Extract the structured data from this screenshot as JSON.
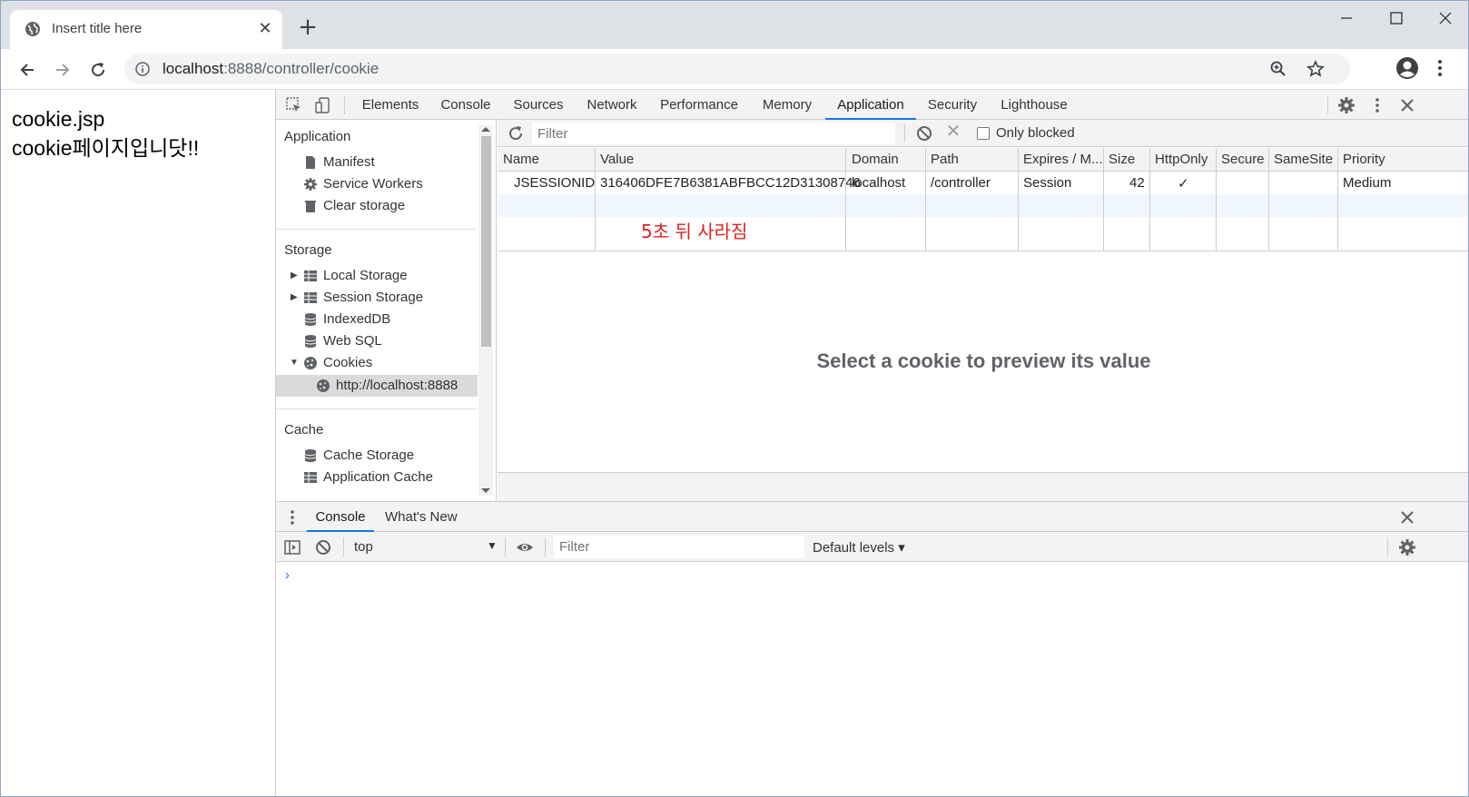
{
  "browser": {
    "tab_title": "Insert title here",
    "url_host": "localhost",
    "url_rest": ":8888/controller/cookie"
  },
  "page": {
    "line1": "cookie.jsp",
    "line2": "cookie페이지입니닷!!"
  },
  "devtools": {
    "tabs": [
      "Elements",
      "Console",
      "Sources",
      "Network",
      "Performance",
      "Memory",
      "Application",
      "Security",
      "Lighthouse"
    ],
    "active_tab": "Application",
    "sidebar": {
      "application_header": "Application",
      "application_items": [
        "Manifest",
        "Service Workers",
        "Clear storage"
      ],
      "storage_header": "Storage",
      "storage_items": [
        "Local Storage",
        "Session Storage",
        "IndexedDB",
        "Web SQL",
        "Cookies"
      ],
      "cookie_origin": "http://localhost:8888",
      "cache_header": "Cache",
      "cache_items": [
        "Cache Storage",
        "Application Cache"
      ]
    },
    "cookies": {
      "filter_placeholder": "Filter",
      "only_blocked_label": "Only blocked",
      "columns": [
        "Name",
        "Value",
        "Domain",
        "Path",
        "Expires / M...",
        "Size",
        "HttpOnly",
        "Secure",
        "SameSite",
        "Priority"
      ],
      "rows": [
        {
          "name": "JSESSIONID",
          "value": "316406DFE7B6381ABFBCC12D31308746",
          "domain": "localhost",
          "path": "/controller",
          "expires": "Session",
          "size": "42",
          "httponly": "✓",
          "secure": "",
          "samesite": "",
          "priority": "Medium"
        }
      ],
      "annotation": "5초 뒤 사라짐",
      "preview_message": "Select a cookie to preview its value"
    },
    "drawer": {
      "tabs": [
        "Console",
        "What's New"
      ],
      "context": "top",
      "filter_placeholder": "Filter",
      "levels": "Default levels ▾",
      "prompt": "›"
    }
  },
  "colors": {
    "accent": "#1a73e8",
    "annotation": "#e02020"
  }
}
